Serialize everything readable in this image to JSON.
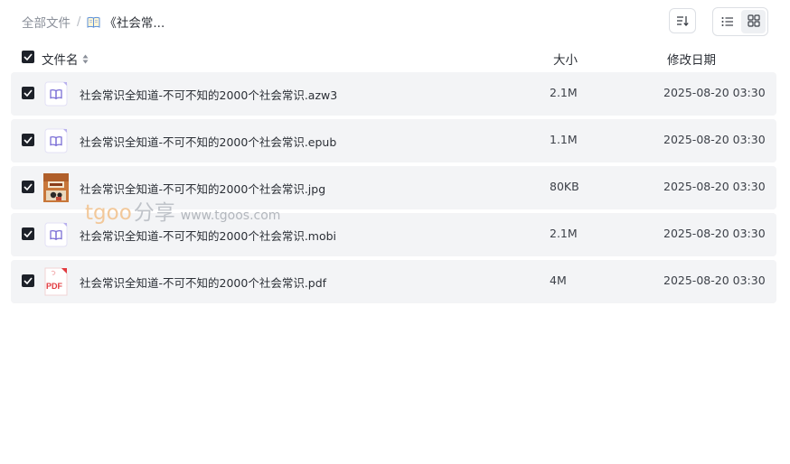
{
  "breadcrumb": {
    "root": "全部文件",
    "separator": "/",
    "current_icon": "book-icon",
    "current": "《社会常..."
  },
  "toolbar": {
    "sort_icon": "sort-icon",
    "list_view_icon": "list-view-icon",
    "grid_view_icon": "grid-view-icon",
    "active_view": "list"
  },
  "columns": {
    "name": "文件名",
    "size": "大小",
    "date": "修改日期"
  },
  "files": [
    {
      "name": "社会常识全知道-不可不知的2000个社会常识.azw3",
      "size": "2.1M",
      "date": "2025-08-20 03:30",
      "icon": "ebook-icon",
      "checked": true
    },
    {
      "name": "社会常识全知道-不可不知的2000个社会常识.epub",
      "size": "1.1M",
      "date": "2025-08-20 03:30",
      "icon": "ebook-icon",
      "checked": true
    },
    {
      "name": "社会常识全知道-不可不知的2000个社会常识.jpg",
      "size": "80KB",
      "date": "2025-08-20 03:30",
      "icon": "image-thumbnail",
      "checked": true
    },
    {
      "name": "社会常识全知道-不可不知的2000个社会常识.mobi",
      "size": "2.1M",
      "date": "2025-08-20 03:30",
      "icon": "ebook-icon",
      "checked": true
    },
    {
      "name": "社会常识全知道-不可不知的2000个社会常识.pdf",
      "size": "4M",
      "date": "2025-08-20 03:30",
      "icon": "pdf-icon",
      "checked": true
    }
  ],
  "pdf_badge": "PDF",
  "watermark": {
    "brand": "tgoo",
    "share": "分享",
    "url": "www.tgoos.com"
  },
  "colors": {
    "row_bg": "#f3f4f6",
    "checkbox": "#1d2129",
    "ebook_accent": "#7b6fd6",
    "pdf_red": "#e2393e",
    "watermark_orange": "#f2c89a"
  }
}
